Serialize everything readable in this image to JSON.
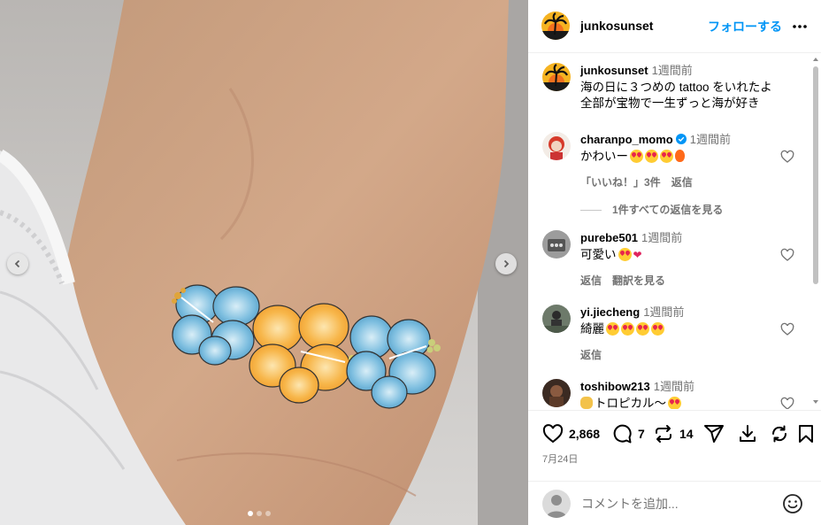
{
  "post": {
    "username": "junkosunset",
    "follow_label": "フォローする",
    "caption_time": "1週間前",
    "caption_line1": "海の日に３つめの tattoo をいれたよ",
    "caption_line2": "全部が宝物で一生ずっと海が好き",
    "date": "7月24日"
  },
  "comments": [
    {
      "username": "charanpo_momo",
      "verified": true,
      "time": "1週間前",
      "text": "かわいー",
      "likes": "「いいね！」3件",
      "reply": "返信",
      "view_replies": "1件すべての返信を見る"
    },
    {
      "username": "purebe501",
      "time": "1週間前",
      "text": "可愛い",
      "reply": "返信",
      "translate": "翻訳を見る"
    },
    {
      "username": "yi.jiecheng",
      "time": "1週間前",
      "text": "綺麗",
      "reply": "返信"
    },
    {
      "username": "toshibow213",
      "time": "1週間前",
      "text": "トロピカル〜"
    }
  ],
  "actions": {
    "like_count": "2,868",
    "comment_count": "7",
    "repost_count": "14"
  },
  "add_comment": {
    "placeholder": "コメントを追加..."
  },
  "carousel": {
    "total": 3,
    "active": 0
  },
  "colors": {
    "accent": "#0095f6",
    "secondary_text": "#737373",
    "divider": "#efefef"
  },
  "icons": [
    "chevron-left-icon",
    "chevron-right-icon",
    "more-icon",
    "heart-icon",
    "comment-icon",
    "repost-icon",
    "share-icon",
    "download-icon",
    "refresh-icon",
    "bookmark-icon",
    "smile-icon",
    "verified-icon"
  ]
}
